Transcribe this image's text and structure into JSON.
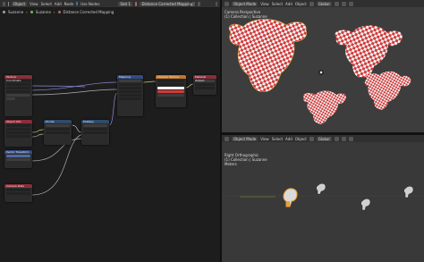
{
  "node_editor": {
    "header": {
      "editor_type": "Object",
      "menu": [
        "View",
        "Select",
        "Add",
        "Node"
      ],
      "use_nodes_label": "Use Nodes",
      "slot": "Slot 1",
      "material": "Distance Corrected Mapping"
    },
    "breadcrumb": [
      "Suzanne",
      "Suzanne",
      "Distance Corrected Mapping"
    ],
    "nodes": [
      {
        "title": "Texture Coordinate",
        "color": "#8b2d3a"
      },
      {
        "title": "Object Info",
        "color": "#8b2d3a"
      },
      {
        "title": "Vector Transform",
        "color": "#334b86"
      },
      {
        "title": "Camera Data",
        "color": "#8b2d3a"
      },
      {
        "title": "Divide",
        "color": "#2f4a6b"
      },
      {
        "title": "Multiply",
        "color": "#2f4a6b"
      },
      {
        "title": "Mapping",
        "color": "#334b86"
      },
      {
        "title": "Checker Texture",
        "color": "#c0762a"
      },
      {
        "title": "Material Output",
        "color": "#8b2d3a"
      }
    ],
    "checker_colors": {
      "color1": "#ffffff",
      "color2": "#d23a3a"
    }
  },
  "viewport_top": {
    "header": {
      "mode": "Object Mode",
      "menu": [
        "View",
        "Select",
        "Add",
        "Object"
      ],
      "orientation": "Global"
    },
    "overlay_line1": "Camera Perspective",
    "overlay_line2": "(1) Collection | Suzanne"
  },
  "viewport_bottom": {
    "header": {
      "mode": "Object Mode",
      "menu": [
        "View",
        "Select",
        "Add",
        "Object"
      ],
      "orientation": "Global"
    },
    "overlay_line1": "Right Orthographic",
    "overlay_line2": "(1) Collection | Suzanne",
    "overlay_line3": "Meters"
  },
  "colors": {
    "checker_red": "#d23a3a",
    "checker_white": "#f2f2f2",
    "selected": "#e8a23a",
    "accent": "#4772b3"
  }
}
